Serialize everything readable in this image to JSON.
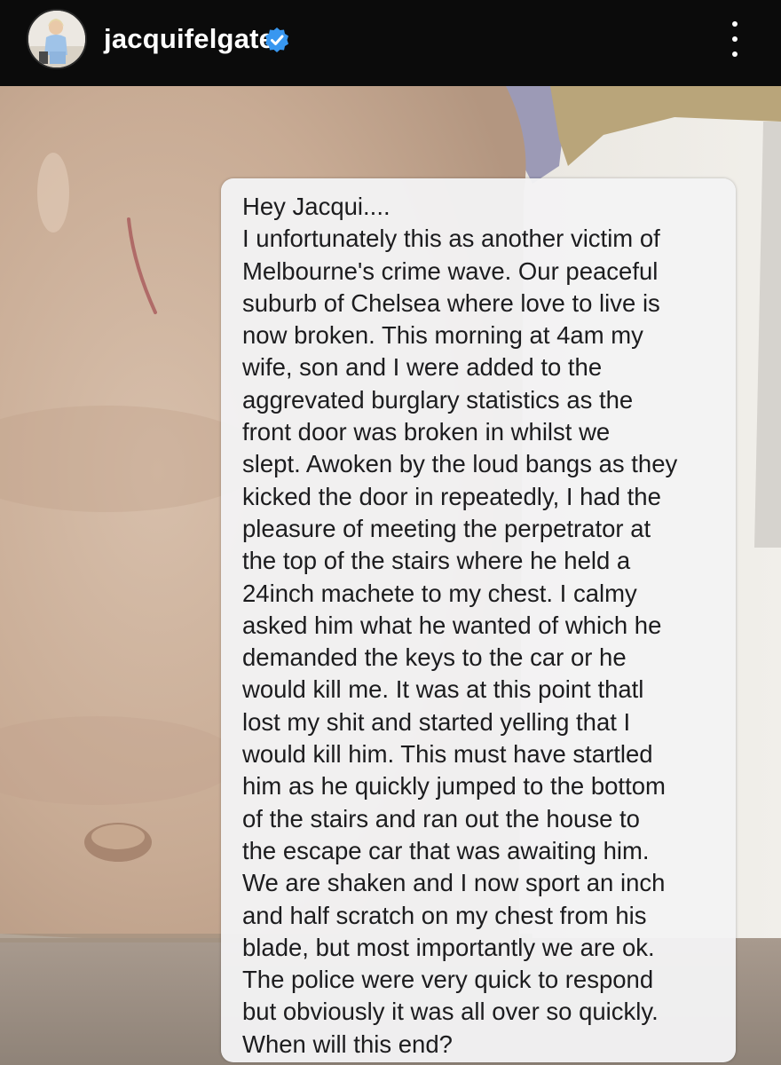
{
  "header": {
    "username": "jacquifelgate",
    "verified": true,
    "avatar_icon": "profile-avatar",
    "more_icon": "more-vertical-icon"
  },
  "message": {
    "lines": [
      "Hey Jacqui....",
      "I unfortunately this as another victim of",
      "Melbourne's crime wave. Our peaceful",
      "suburb of Chelsea where love to live is",
      "now broken. This morning at 4am my",
      "wife, son and I were added to the",
      "aggrevated burglary statistics as the",
      "front door was broken in whilst we",
      "slept. Awoken by the loud bangs as they",
      "kicked the door in repeatedly, I had the",
      "pleasure of meeting the perpetrator at",
      "the top of the stairs where he held a",
      "24inch machete to my chest. I calmy",
      "asked him what he wanted of which he",
      "demanded the keys to the car or he",
      "would kill me. It was at this point thatl",
      "lost my shit and started yelling that I",
      "would kill him. This must have startled",
      "him as he quickly jumped to the bottom",
      "of the stairs and ran out the house to",
      "the escape car that was awaiting him.",
      "We are shaken and I now sport an inch",
      "and half scratch on my chest from his",
      "blade, but most importantly we are ok.",
      "The police were very quick to respond",
      "but obviously it was all over so quickly.",
      "When will this end?"
    ]
  },
  "colors": {
    "header_bg": "#0b0b0b",
    "verified_blue": "#3897f0",
    "message_bg": "#f2f2f4",
    "message_text": "#1c1c1e",
    "skin": "#c9ae98"
  }
}
